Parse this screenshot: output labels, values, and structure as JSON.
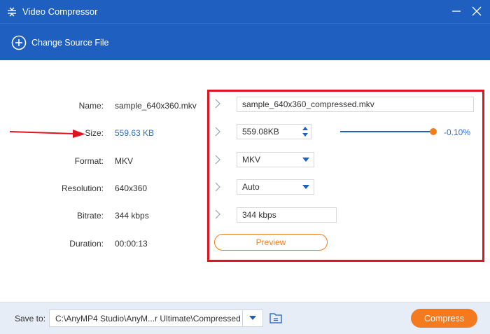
{
  "window": {
    "title": "Video Compressor"
  },
  "toolbar": {
    "change_source_label": "Change Source File"
  },
  "source": {
    "name_label": "Name:",
    "name_value": "sample_640x360.mkv",
    "size_label": "Size:",
    "size_value": "559.63 KB",
    "format_label": "Format:",
    "format_value": "MKV",
    "resolution_label": "Resolution:",
    "resolution_value": "640x360",
    "bitrate_label": "Bitrate:",
    "bitrate_value": "344 kbps",
    "duration_label": "Duration:",
    "duration_value": "00:00:13"
  },
  "output": {
    "name": "sample_640x360_compressed.mkv",
    "size": "559.08KB",
    "size_percent": "-0.10%",
    "slider_level_percent": 99.9,
    "format": "MKV",
    "resolution": "Auto",
    "bitrate": "344 kbps",
    "preview_label": "Preview"
  },
  "footer": {
    "save_to_label": "Save to:",
    "path": "C:\\AnyMP4 Studio\\AnyM...r Ultimate\\Compressed",
    "compress_label": "Compress"
  },
  "colors": {
    "header": "#1f5fbf",
    "accent": "#f47a20",
    "annotation": "#e0141e",
    "link": "#2e6fcf"
  },
  "icons": [
    "compress-app-icon",
    "minimize-icon",
    "close-icon",
    "plus-circle-icon",
    "chevron-right-icon",
    "spin-arrows-icon",
    "caret-down-icon",
    "folder-icon",
    "red-arrow-annotation"
  ]
}
